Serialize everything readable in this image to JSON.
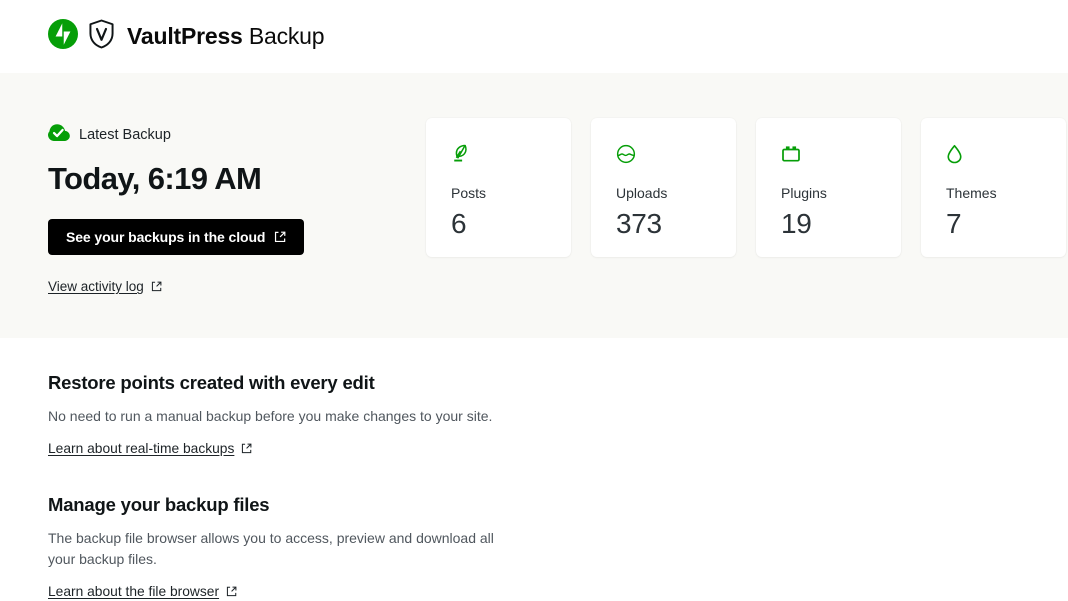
{
  "header": {
    "jetpack_icon": "jetpack-logo-icon",
    "shield_icon": "vaultpress-shield-icon",
    "brand_strong": "VaultPress",
    "brand_light": "Backup"
  },
  "hero": {
    "status_icon": "cloud-check-icon",
    "status_label": "Latest Backup",
    "backup_time": "Today, 6:19 AM",
    "cloud_button_label": "See your backups in the cloud",
    "cloud_button_icon": "external-link-icon",
    "activity_link_label": "View activity log",
    "activity_link_icon": "external-link-icon",
    "background_color": "#f9f9f6"
  },
  "stats": [
    {
      "icon": "post-quill-icon",
      "label": "Posts",
      "value": "6"
    },
    {
      "icon": "media-image-icon",
      "label": "Uploads",
      "value": "373"
    },
    {
      "icon": "plugin-plug-icon",
      "label": "Plugins",
      "value": "19"
    },
    {
      "icon": "theme-droplet-icon",
      "label": "Themes",
      "value": "7"
    }
  ],
  "sections": [
    {
      "title": "Restore points created with every edit",
      "body": "No need to run a manual backup before you make changes to your site.",
      "link_label": "Learn about real-time backups",
      "link_icon": "external-link-icon"
    },
    {
      "title": "Manage your backup files",
      "body": "The backup file browser allows you to access, preview and download all your backup files.",
      "link_label": "Learn about the file browser",
      "link_icon": "external-link-icon"
    }
  ],
  "colors": {
    "accent_green": "#069e08",
    "button_black": "#000000",
    "hero_bg": "#f9f9f6",
    "card_bg": "#ffffff"
  }
}
